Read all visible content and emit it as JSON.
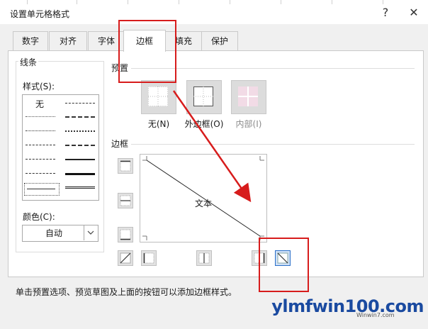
{
  "dialog": {
    "title": "设置单元格格式",
    "help_glyph": "?",
    "close_glyph": "✕"
  },
  "tabs": [
    {
      "label": "数字"
    },
    {
      "label": "对齐"
    },
    {
      "label": "字体"
    },
    {
      "label": "边框",
      "active": true
    },
    {
      "label": "填充"
    },
    {
      "label": "保护"
    }
  ],
  "line_group": {
    "title": "线条",
    "style_label": "样式(S):",
    "none_label": "无",
    "color_label": "颜色(C):",
    "color_value": "自动"
  },
  "preset_group": {
    "title": "预置",
    "buttons": [
      {
        "label": "无(N)",
        "icon": "border-none-icon"
      },
      {
        "label": "外边框(O)",
        "icon": "border-outline-icon"
      },
      {
        "label": "内部(I)",
        "icon": "border-inside-icon",
        "disabled": true
      }
    ]
  },
  "border_group": {
    "title": "边框",
    "preview_text": "文本",
    "side_buttons": [
      "border-top-icon",
      "border-middle-horizontal-icon",
      "border-bottom-icon",
      "diagonal-up-icon",
      "border-left-icon",
      "border-middle-vertical-icon",
      "border-right-icon",
      "diagonal-down-icon"
    ],
    "selected": "diagonal-down-icon"
  },
  "hint": "单击预置选项、预览草图及上面的按钮可以添加边框样式。",
  "watermark": {
    "text": "ylmfwin100.com",
    "small": "Winwin7.com"
  },
  "colors": {
    "accent_red": "#d71c1c",
    "selected_blue": "#2a6fc9"
  }
}
